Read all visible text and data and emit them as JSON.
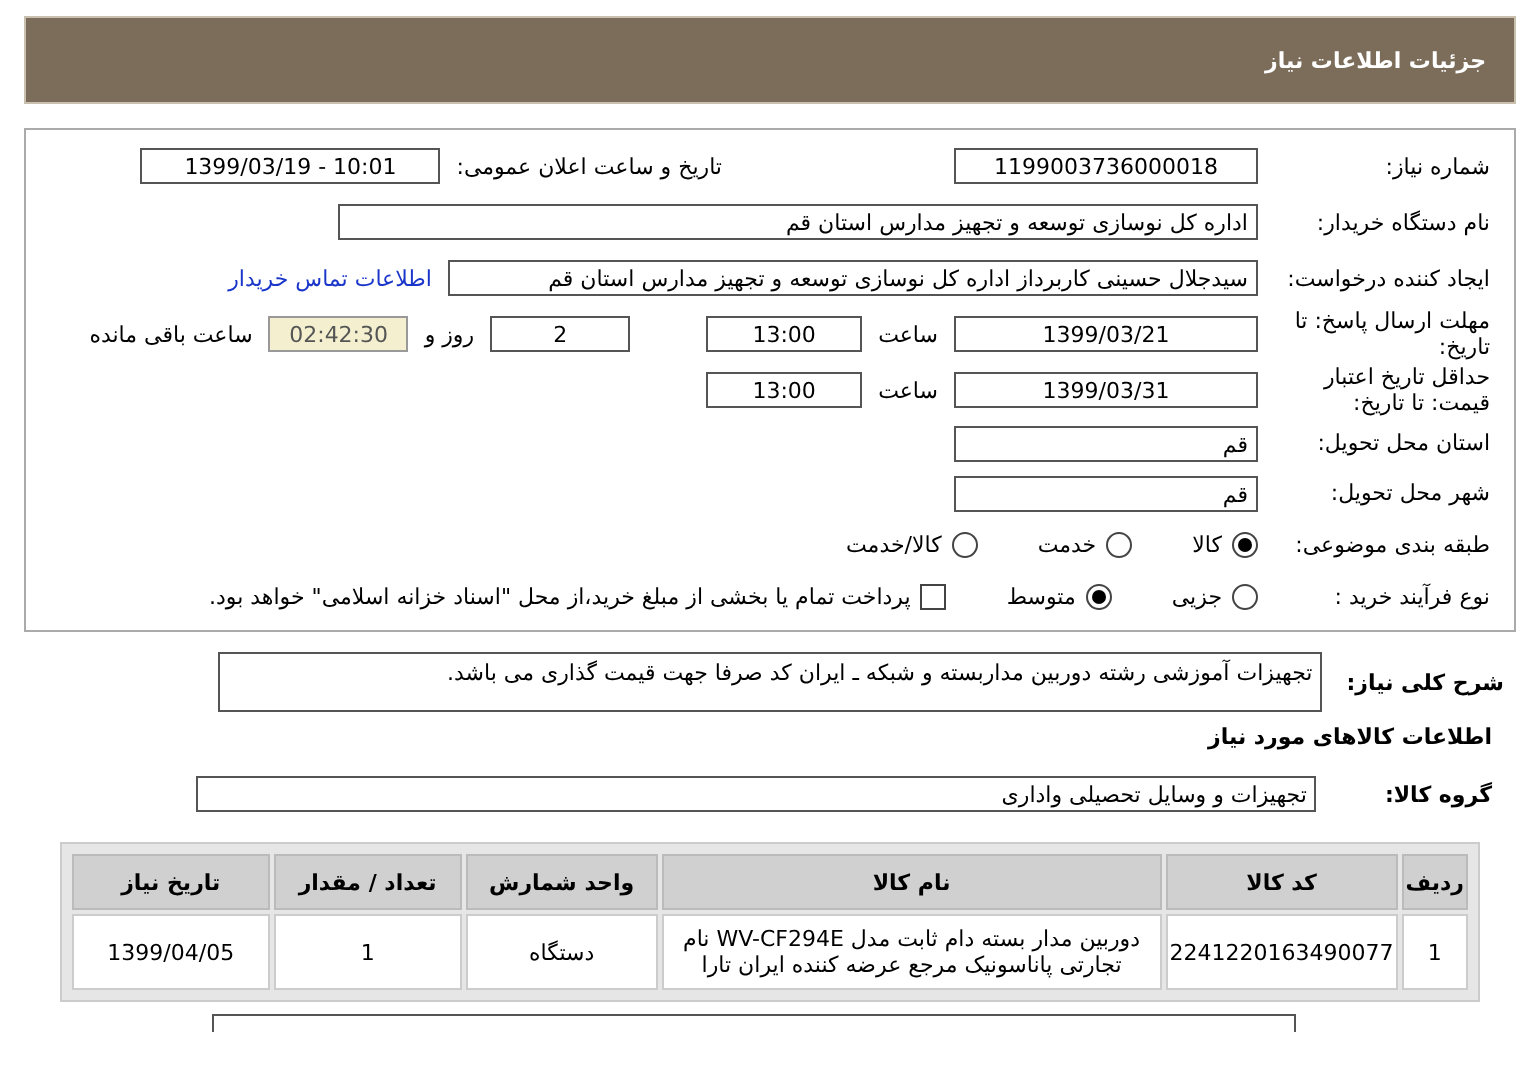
{
  "header": {
    "title": "جزئیات اطلاعات نیاز"
  },
  "fields": {
    "need_number": {
      "label": "شماره نیاز:",
      "value": "1199003736000018"
    },
    "announce": {
      "label": "تاریخ و ساعت اعلان عمومی:",
      "value": "1399/03/19 - 10:01"
    },
    "buyer": {
      "label": "نام دستگاه خریدار:",
      "value": "اداره کل نوسازی توسعه و تجهیز مدارس استان قم"
    },
    "creator": {
      "label": "ایجاد کننده درخواست:",
      "value": "سیدجلال حسینی کاربرداز اداره کل نوسازی توسعه و تجهیز مدارس استان قم",
      "link": "اطلاعات تماس خریدار"
    },
    "deadline": {
      "label": "مهلت ارسال پاسخ: تا تاریخ:",
      "date": "1399/03/21",
      "time_label": "ساعت",
      "time": "13:00",
      "days": "2",
      "days_label": "روز و",
      "remaining": "02:42:30",
      "remaining_label": "ساعت باقی مانده"
    },
    "validity": {
      "label": "حداقل تاریخ اعتبار قیمت: تا تاریخ:",
      "date": "1399/03/31",
      "time_label": "ساعت",
      "time": "13:00"
    },
    "province": {
      "label": "استان محل تحویل:",
      "value": "قم"
    },
    "city": {
      "label": "شهر محل تحویل:",
      "value": "قم"
    },
    "category": {
      "label": "طبقه بندی موضوعی:",
      "options": [
        {
          "label": "کالا",
          "selected": true
        },
        {
          "label": "خدمت",
          "selected": false
        },
        {
          "label": "کالا/خدمت",
          "selected": false
        }
      ]
    },
    "process": {
      "label": "نوع فرآیند خرید :",
      "options": [
        {
          "label": "جزیی",
          "selected": false
        },
        {
          "label": "متوسط",
          "selected": true
        }
      ],
      "payment": {
        "label": "پرداخت تمام یا بخشی از مبلغ خرید،از محل \"اسناد خزانه اسلامی\" خواهد بود.",
        "checked": false
      }
    }
  },
  "summary": {
    "label": "شرح کلی نیاز:",
    "value": "تجهیزات آموزشی رشته دوربین مداربسته و شبکه ـ ایران کد صرفا جهت قیمت گذاری می باشد."
  },
  "goods_title": "اطلاعات کالاهای مورد نیاز",
  "group": {
    "label": "گروه کالا:",
    "value": "تجهیزات و وسایل تحصیلی واداری"
  },
  "table": {
    "columns": [
      "ردیف",
      "کد کالا",
      "نام کالا",
      "واحد شمارش",
      "تعداد / مقدار",
      "تاریخ نیاز"
    ],
    "rows": [
      [
        "1",
        "2241220163490077",
        "دوربین مدار بسته دام ثابت مدل WV-CF294E نام تجارتی پاناسونیک مرجع عرضه کننده ایران تارا",
        "دستگاه",
        "1",
        "1399/04/05"
      ]
    ]
  }
}
